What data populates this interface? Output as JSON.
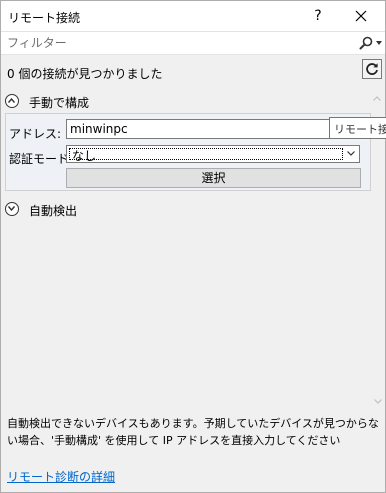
{
  "window": {
    "title": "リモート接続",
    "help_label": "?"
  },
  "filter": {
    "placeholder": "フィルター"
  },
  "status": {
    "connections_found": "0 個の接続が見つかりました"
  },
  "manual": {
    "header": "手動で構成",
    "address_label": "アドレス:",
    "address_value": "minwinpc",
    "tooltip": "リモート接続",
    "auth_label": "認証モード:",
    "auth_value": "なし",
    "select_button": "選択"
  },
  "auto": {
    "header": "自動検出"
  },
  "info": {
    "text": "自動検出できないデバイスもあります。予期していたデバイスが見つからない場合、'手動構成' を使用して IP アドレスを直接入力してください",
    "link": "リモート診断の詳細"
  }
}
